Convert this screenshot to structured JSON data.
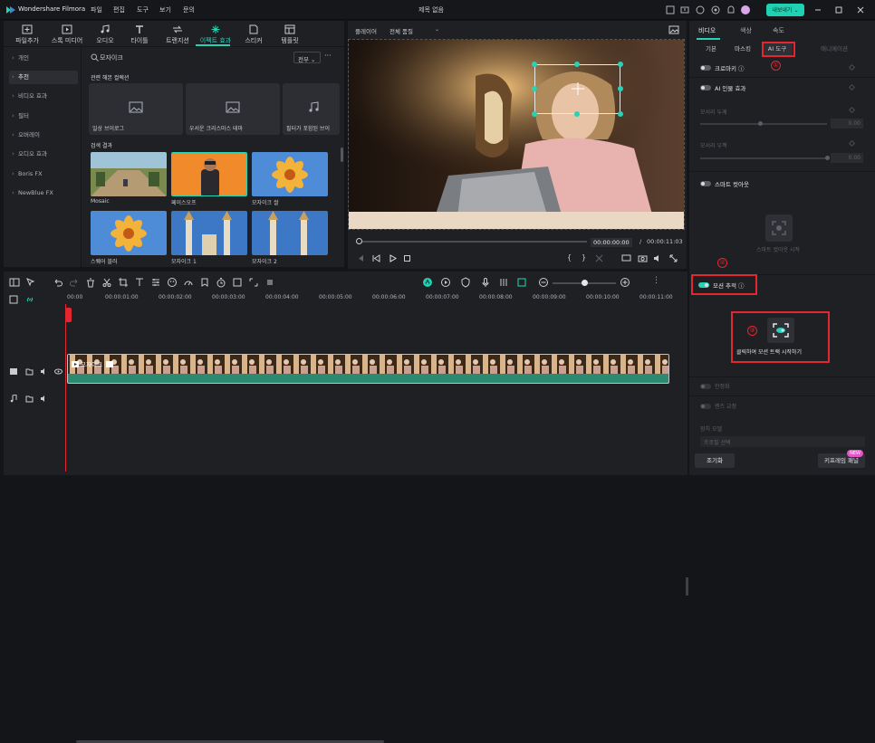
{
  "app": {
    "name": "Wondershare Filmora",
    "doc_title": "제목 없음",
    "export_label": "내보내기",
    "export_chev": "⌄"
  },
  "menu": [
    "파일",
    "편집",
    "도구",
    "보기",
    "문의"
  ],
  "media_tabs": [
    {
      "label": "파일추가",
      "icon": "import-icon"
    },
    {
      "label": "스톡 미디어",
      "icon": "stock-media-icon"
    },
    {
      "label": "오디오",
      "icon": "audio-icon"
    },
    {
      "label": "타이틀",
      "icon": "titles-icon"
    },
    {
      "label": "트랜지션",
      "icon": "transitions-icon"
    },
    {
      "label": "이펙트 효과",
      "icon": "effects-icon",
      "active": true
    },
    {
      "label": "스티커",
      "icon": "stickers-icon"
    },
    {
      "label": "템플릿",
      "icon": "templates-icon"
    }
  ],
  "sidebar": [
    "개인",
    "추천",
    "비디오 효과",
    "필터",
    "오버레이",
    "오디오 효과",
    "Boris FX",
    "NewBlue FX"
  ],
  "search": {
    "value": "모자이크",
    "filter": "전부"
  },
  "sections": {
    "related": "관련 해본 컬렉션",
    "results": "검색 결과"
  },
  "related_cards": [
    "일상 브이로그",
    "우서운 크리스마스 테마",
    "필터가 포함된 브이"
  ],
  "results": [
    "Mosaic",
    "페이스오프",
    "모자이크 쌀",
    "스퀘어 블러",
    "모자이크 1",
    "모자이크 2"
  ],
  "player": {
    "label": "플레이어",
    "quality": "전체 품질",
    "time_current": "00:00:00:00",
    "time_sep": "/",
    "time_total": "00:00:11:03"
  },
  "right_tabs": [
    "비디오",
    "색상",
    "속도"
  ],
  "right_subtabs": [
    "기본",
    "마스킹",
    "AI 도구",
    "애니메이션"
  ],
  "right_rows": {
    "chroma": "크로마키 ⓘ",
    "ai_portrait": "AI 인물 효과",
    "edge_thick": "모서리 두께",
    "edge_thick_val": "0.00",
    "edge_feather": "모서리 우깩",
    "edge_feather_val": "0.00",
    "smart_cutout": "스마트 컷아웃",
    "smart_cutout_hint": "스마트 컷아웃 시작",
    "motion_track": "모션 추적 ⓘ",
    "motion_track_start": "클릭하여 모션 트랙 시작하기",
    "stabilize": "안정화",
    "lens_fix": "렌즈 교정",
    "change_model": "장치 모델",
    "model_placeholder": "프로필 선택"
  },
  "right_buttons": {
    "reset": "조기화",
    "keyframe": "키프레임 패널",
    "new": "NEW"
  },
  "annotations": [
    "①",
    "②",
    "③"
  ],
  "timeline": {
    "ticks": [
      "00:00",
      "00:00:01:00",
      "00:00:02:00",
      "00:00:03:00",
      "00:00:04:00",
      "00:00:05:00",
      "00:00:06:00",
      "00:00:07:00",
      "00:00:08:00",
      "00:00:09:00",
      "00:00:10:00",
      "00:00:11:00"
    ],
    "clip_label": "모자이크"
  },
  "colors": {
    "accent": "#25d3b7",
    "highlight": "#e3262f",
    "panel": "#1f2024",
    "clip": "#2d8a72"
  }
}
